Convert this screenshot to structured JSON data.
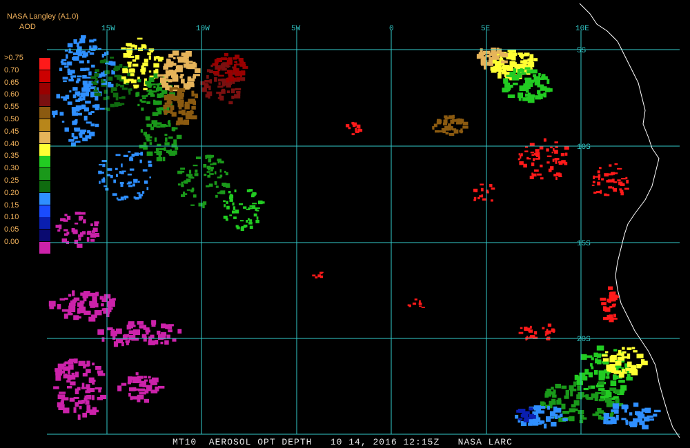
{
  "header": {
    "org": "NASA Langley (A1.0)",
    "product": "AOD"
  },
  "legend": {
    "labels": [
      ">0.75",
      "0.70",
      "0.65",
      "0.60",
      "0.55",
      "0.50",
      "0.45",
      "0.40",
      "0.35",
      "0.30",
      "0.25",
      "0.20",
      "0.15",
      "0.10",
      "0.05",
      "0.00"
    ],
    "colors": [
      "#ff1a1a",
      "#cc0000",
      "#990000",
      "#7a1010",
      "#8b5a10",
      "#b8861a",
      "#e6b45a",
      "#ffff33",
      "#22cc22",
      "#1a991a",
      "#0f6b0f",
      "#2f8fff",
      "#1a4cff",
      "#0a1fb0",
      "#0a0a70",
      "#cc22aa"
    ]
  },
  "map": {
    "lon_labels": [
      "15W",
      "10W",
      "5W",
      "0",
      "5E",
      "10E"
    ],
    "lat_labels": [
      "5S",
      "10S",
      "15S",
      "20S"
    ],
    "grid_color": "#33cccc",
    "coast_color": "#ffffff"
  },
  "footer": {
    "caption": "MT10  AEROSOL OPT DEPTH   10 14, 2016 12:15Z   NASA LARC"
  }
}
